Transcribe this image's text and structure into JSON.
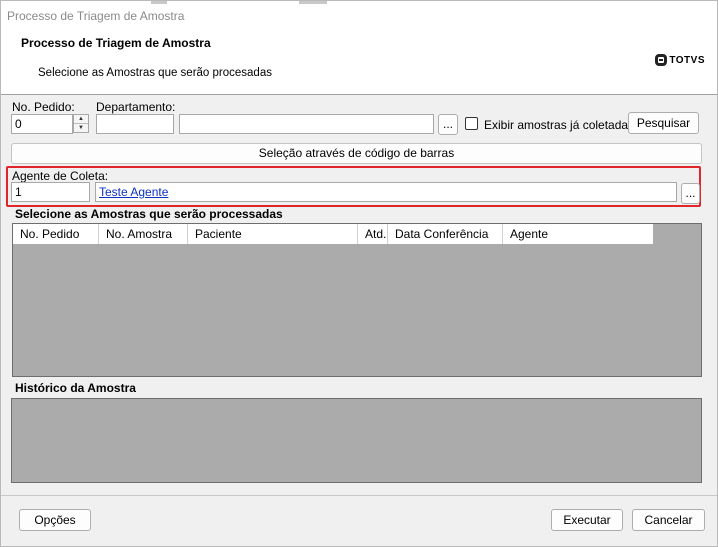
{
  "window": {
    "title": "Processo de Triagem de Amostra"
  },
  "header": {
    "title": "Processo de Triagem de Amostra",
    "subtitle": "Selecione as Amostras que serão procesadas",
    "logo": "TOTVS"
  },
  "form": {
    "pedido_label": "No. Pedido:",
    "pedido_value": "0",
    "departamento_label": "Departamento:",
    "departamento_code": "",
    "departamento_name": "",
    "browse_label": "...",
    "exibir_label": "Exibir amostras já coletadas",
    "exibir_checked": false,
    "pesquisar_label": "Pesquisar",
    "barcode_label": "Seleção através de código de barras",
    "agente_label": "Agente de Coleta:",
    "agente_code": "1",
    "agente_name": "Teste Agente",
    "agente_browse_label": "..."
  },
  "amostras": {
    "title": "Selecione as Amostras que serão processadas",
    "columns": [
      "No. Pedido",
      "No. Amostra",
      "Paciente",
      "Atd.",
      "Data Conferência",
      "Agente"
    ],
    "rows": []
  },
  "historico": {
    "title": "Histórico da Amostra"
  },
  "footer": {
    "opcoes_label": "Opções",
    "executar_label": "Executar",
    "cancelar_label": "Cancelar"
  },
  "colors": {
    "highlight_border": "#e0252b",
    "grid_bg": "#ababab",
    "link": "#0b32c2"
  }
}
